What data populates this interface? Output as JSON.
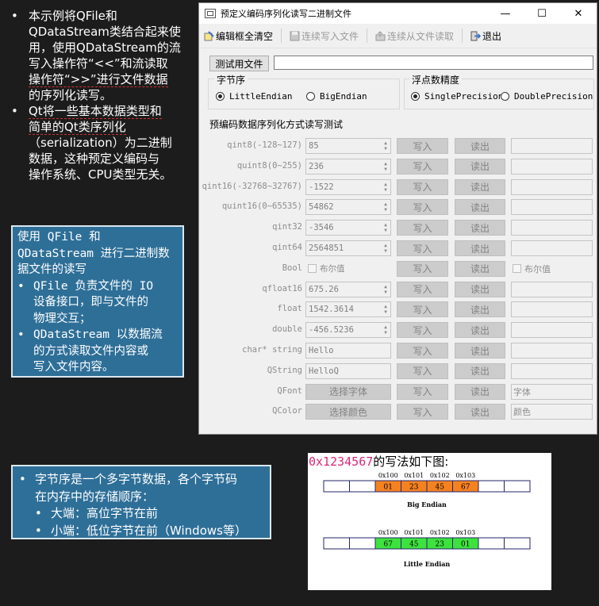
{
  "intro": {
    "b1_lines": [
      "本示例将QFile和",
      "QDataStream类结合起来使",
      "用，使用QDataStream的流",
      "写入操作符“<<”和流读取",
      "操作符“>>”进行文件数据",
      "的序列化读写。"
    ],
    "b2_lines": [
      "Qt将一些基本数据类型和",
      "简单的Qt类序列化",
      "（serialization）为二进制",
      "数据，这种预定义编码与",
      "操作系统、CPU类型无关。"
    ]
  },
  "box1": {
    "heading_lines": [
      "使用 QFile 和",
      "QDataStream 进行二进制数",
      "据文件的读写"
    ],
    "item1_lines": [
      "QFile 负责文件的 IO",
      "设备接口，即与文件的",
      "物理交互；"
    ],
    "item2_lines": [
      "QDataStream 以数据流",
      "的方式读取文件内容或",
      "写入文件内容。"
    ]
  },
  "box2": {
    "item_lines": [
      "字节序是一个多字节数据，各个字节码",
      "在内存中的存储顺序："
    ],
    "sub1": "大端：高位字节在前",
    "sub2": "小端：低位字节在前（Windows等）"
  },
  "window": {
    "title": "预定义编码序列化读写二进制文件",
    "minimize": "—",
    "maximize": "☐",
    "close": "✕",
    "toolbar": {
      "clear": "编辑框全清空",
      "write_all": "连续写入文件",
      "read_all": "连续从文件读取",
      "exit": "退出"
    },
    "test_file_button": "测试用文件",
    "test_file_value": "",
    "byte_order": {
      "label": "字节序",
      "little": "LittleEndian",
      "big": "BigEndian"
    },
    "float_precision": {
      "label": "浮点数精度",
      "single": "SinglePrecision",
      "double": "DoublePrecision"
    },
    "section_title": "预编码数据序列化方式读写测试",
    "write_label": "写入",
    "read_label": "读出",
    "rows": [
      {
        "label": "qint8(-128~127)",
        "value": "85",
        "spin": true,
        "out": ""
      },
      {
        "label": "quint8(0~255)",
        "value": "236",
        "spin": true,
        "out": ""
      },
      {
        "label": "qint16(-32768~32767)",
        "value": "-1522",
        "spin": true,
        "out": ""
      },
      {
        "label": "quint16(0~65535)",
        "value": "54862",
        "spin": true,
        "out": ""
      },
      {
        "label": "qint32",
        "value": "-3546",
        "spin": true,
        "out": ""
      },
      {
        "label": "qint64",
        "value": "2564851",
        "spin": true,
        "out": ""
      },
      {
        "label": "Bool",
        "value": "布尔值",
        "checkbox": true,
        "out": "布尔值"
      },
      {
        "label": "qfloat16",
        "value": "675.26",
        "spin": true,
        "out": ""
      },
      {
        "label": "float",
        "value": "1542.3614",
        "spin": true,
        "out": ""
      },
      {
        "label": "double",
        "value": "-456.5236",
        "spin": true,
        "out": ""
      },
      {
        "label": "char* string",
        "value": "Hello",
        "out": ""
      },
      {
        "label": "QString",
        "value": "HelloQ",
        "out": ""
      },
      {
        "label": "QFont",
        "value": "选择字体",
        "button": true,
        "out": "字体"
      },
      {
        "label": "QColor",
        "value": "选择颜色",
        "button": true,
        "out": "颜色"
      }
    ]
  },
  "figure": {
    "title_hex": "0x1234567",
    "title_rest": "的写法如下图:",
    "addresses": [
      "0x100",
      "0x101",
      "0x102",
      "0x103"
    ],
    "big_bytes": [
      "01",
      "23",
      "45",
      "67"
    ],
    "little_bytes": [
      "67",
      "45",
      "23",
      "01"
    ],
    "big_label": "Big Endian",
    "little_label": "Little Endian",
    "colors": {
      "big": "#f58220",
      "little": "#3ee23e",
      "border": "#24246b"
    }
  }
}
